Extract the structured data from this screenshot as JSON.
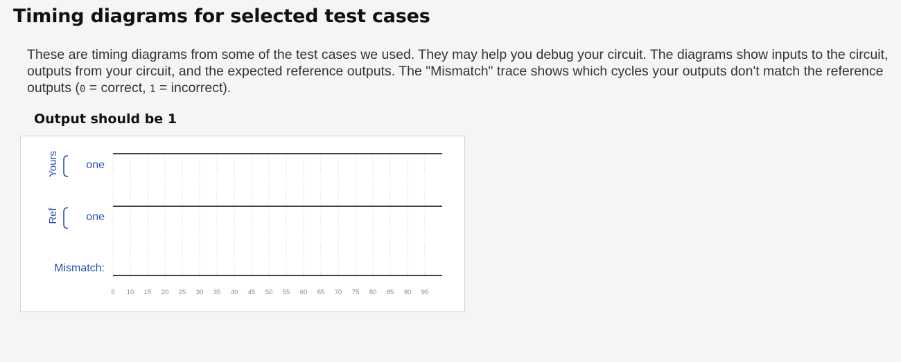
{
  "heading": "Timing diagrams for selected test cases",
  "description": {
    "part1": "These are timing diagrams from some of the test cases we used. They may help you debug your circuit. The diagrams show inputs to the circuit, outputs from your circuit, and the expected reference outputs. The \"Mismatch\" trace shows which cycles your outputs don't match the reference outputs (",
    "code0": "0",
    "part2": " = correct, ",
    "code1": "1",
    "part3": " = incorrect)."
  },
  "testcase": {
    "title": "Output should be 1",
    "groups": {
      "yours": "Yours",
      "ref": "Ref"
    },
    "signals": {
      "yours_one": "one",
      "ref_one": "one",
      "mismatch": "Mismatch:"
    },
    "signal_values": {
      "yours_one": 1,
      "ref_one": 1,
      "mismatch": 0
    },
    "time_ticks": [
      "5",
      "10",
      "15",
      "20",
      "25",
      "30",
      "35",
      "40",
      "45",
      "50",
      "55",
      "60",
      "65",
      "70",
      "75",
      "80",
      "85",
      "90",
      "95"
    ],
    "colors": {
      "group_label": "#2a4db0",
      "bracket": "#2a4db0",
      "trace": "#000000",
      "grid": "#d0d0d0",
      "tick_label": "#888888"
    }
  }
}
